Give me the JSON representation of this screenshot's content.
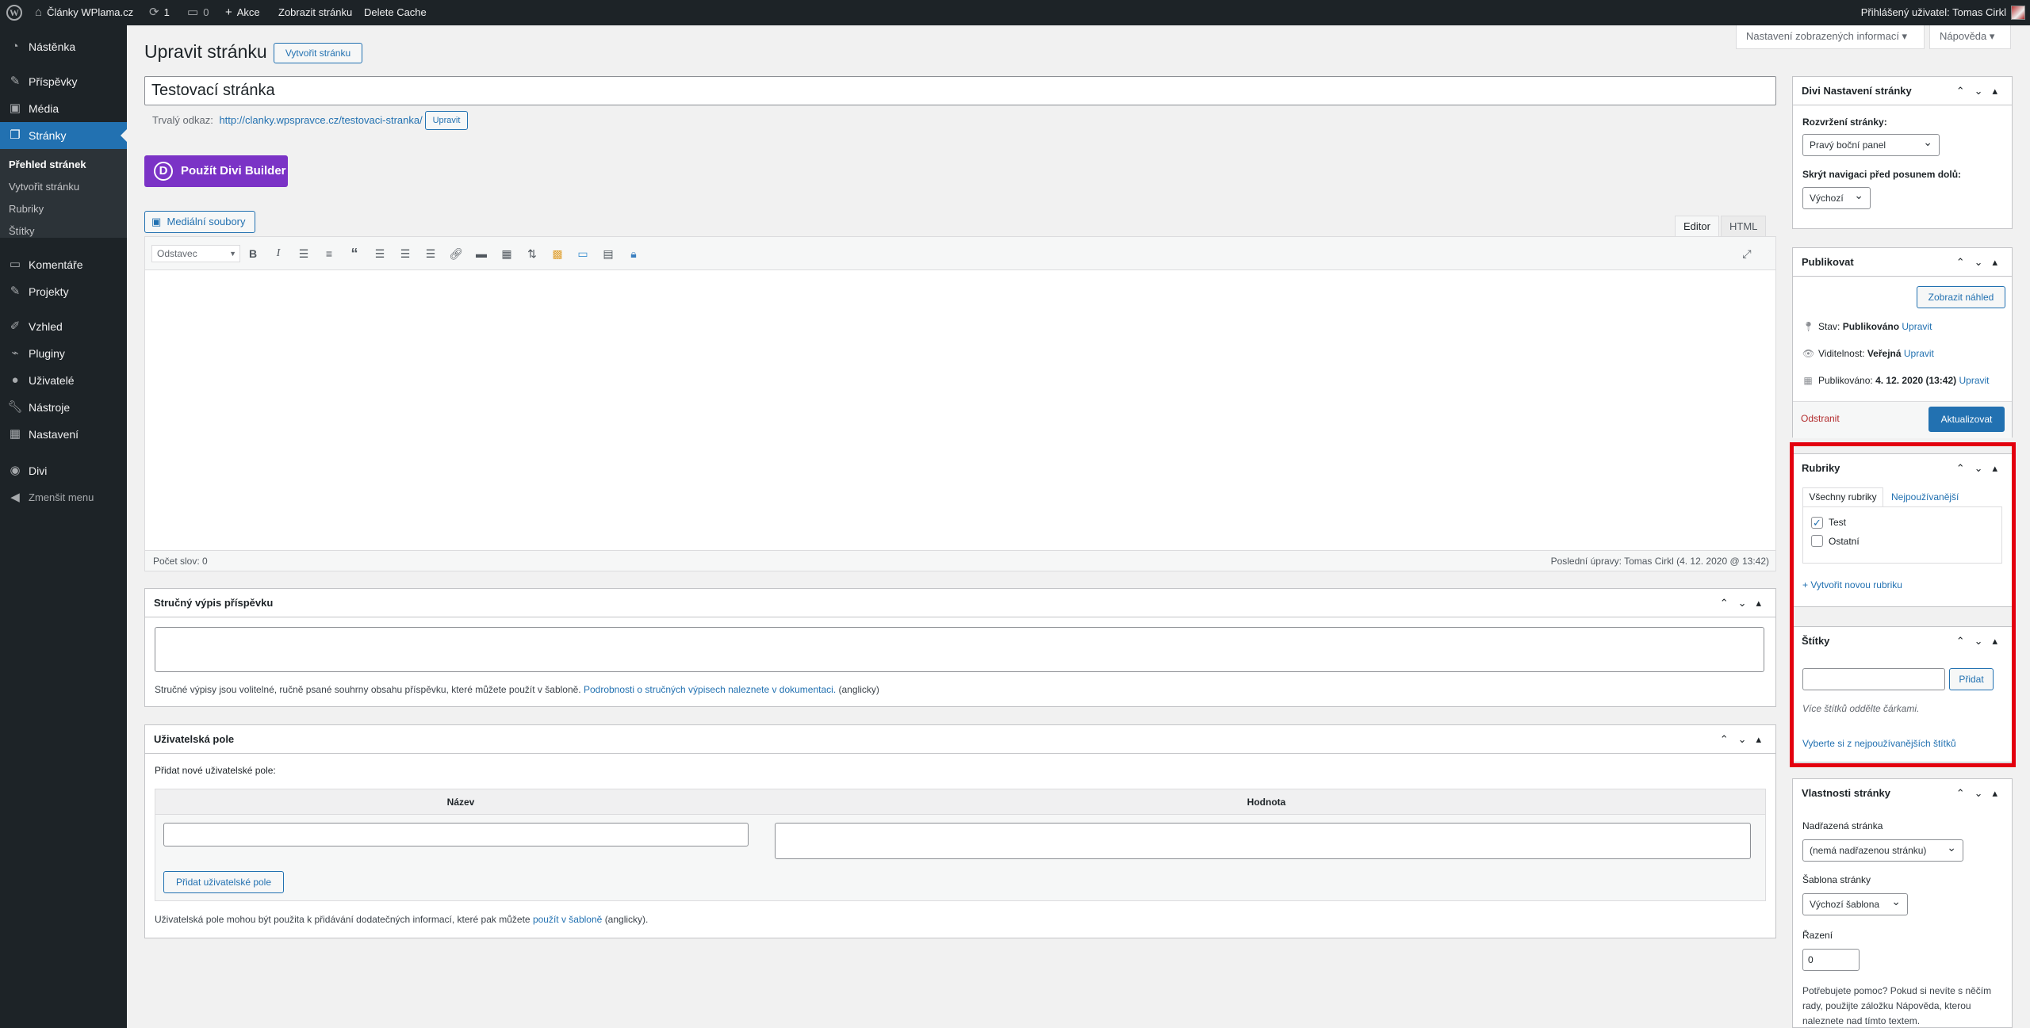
{
  "adminbar": {
    "site_name": "Články WPlama.cz",
    "updates_count": "1",
    "comments_count": "0",
    "new_label": "Akce",
    "view_page": "Zobrazit stránku",
    "delete_cache": "Delete Cache",
    "howdy": "Přihlášený uživatel: Tomas Cirkl"
  },
  "sidebar": {
    "items": [
      {
        "label": "Nástěnka",
        "icon": "dashboard-icon"
      },
      {
        "label": "Příspěvky",
        "icon": "pin-icon"
      },
      {
        "label": "Média",
        "icon": "media-icon"
      },
      {
        "label": "Stránky",
        "icon": "pages-icon"
      },
      {
        "label": "Komentáře",
        "icon": "comments-icon"
      },
      {
        "label": "Projekty",
        "icon": "pin-icon"
      },
      {
        "label": "Vzhled",
        "icon": "appearance-icon"
      },
      {
        "label": "Pluginy",
        "icon": "plugins-icon"
      },
      {
        "label": "Uživatelé",
        "icon": "users-icon"
      },
      {
        "label": "Nástroje",
        "icon": "tools-icon"
      },
      {
        "label": "Nastavení",
        "icon": "settings-icon"
      },
      {
        "label": "Divi",
        "icon": "divi-icon"
      },
      {
        "label": "Zmenšit menu",
        "icon": "collapse-icon"
      }
    ],
    "submenu": [
      "Přehled stránek",
      "Vytvořit stránku",
      "Rubriky",
      "Štítky"
    ]
  },
  "header": {
    "title": "Upravit stránku",
    "add_new": "Vytvořit stránku",
    "screen_options": "Nastavení zobrazených informací",
    "help": "Nápověda"
  },
  "post": {
    "title_value": "Testovací stránka",
    "permalink_label": "Trvalý odkaz:",
    "permalink_url": "http://clanky.wpspravce.cz/testovaci-stranka/",
    "permalink_edit": "Upravit",
    "divi_button": "Použít Divi Builder",
    "divi_letter": "D"
  },
  "editor": {
    "media_button": "Mediální soubory",
    "tab_visual": "Editor",
    "tab_html": "HTML",
    "format_select": "Odstavec",
    "word_count": "Počet slov: 0",
    "last_edit": "Poslední úpravy: Tomas Cirkl (4. 12. 2020 @ 13:42)"
  },
  "excerpt": {
    "title": "Stručný výpis příspěvku",
    "help_text": "Stručné výpisy jsou volitelné, ručně psané souhrny obsahu příspěvku, které můžete použít v šabloně.",
    "help_link": "Podrobnosti o stručných výpisech naleznete v dokumentaci.",
    "help_suffix": "(anglicky)"
  },
  "custom_fields": {
    "title": "Uživatelská pole",
    "add_new_label": "Přidat nové uživatelské pole:",
    "col_name": "Název",
    "col_value": "Hodnota",
    "add_button": "Přidat uživatelské pole",
    "help_text": "Uživatelská pole mohou být použita k přidávání dodatečných informací, které pak můžete",
    "help_link": "použít v šabloně",
    "help_suffix": "(anglicky)."
  },
  "divi_settings": {
    "title": "Divi Nastavení stránky",
    "layout_label": "Rozvržení stránky:",
    "layout_value": "Pravý boční panel",
    "hide_nav_label": "Skrýt navigaci před posunem dolů:",
    "hide_nav_value": "Výchozí"
  },
  "publish": {
    "title": "Publikovat",
    "preview": "Zobrazit náhled",
    "status_label": "Stav:",
    "status_value": "Publikováno",
    "visibility_label": "Viditelnost:",
    "visibility_value": "Veřejná",
    "published_label": "Publikováno:",
    "published_value": "4. 12. 2020 (13:42)",
    "edit": "Upravit",
    "trash": "Odstranit",
    "update": "Aktualizovat"
  },
  "categories": {
    "title": "Rubriky",
    "tab_all": "Všechny rubriky",
    "tab_popular": "Nejpoužívanější",
    "items": [
      {
        "label": "Test",
        "checked": true
      },
      {
        "label": "Ostatní",
        "checked": false
      }
    ],
    "add_new": "+ Vytvořit novou rubriku"
  },
  "tags": {
    "title": "Štítky",
    "add_button": "Přidat",
    "hint": "Více štítků oddělte čárkami.",
    "choose_link": "Vyberte si z nejpoužívanějších štítků"
  },
  "page_attributes": {
    "title": "Vlastnosti stránky",
    "parent_label": "Nadřazená stránka",
    "parent_value": "(nemá nadřazenou stránku)",
    "template_label": "Šablona stránky",
    "template_value": "Výchozí šablona",
    "order_label": "Řazení",
    "order_value": "0",
    "help_text": "Potřebujete pomoc? Pokud si nevíte s něčím rady, použijte záložku Nápověda, kterou naleznete nad tímto textem."
  },
  "colors": {
    "accent": "#2271b1",
    "divi": "#7b33c6",
    "highlight": "#e3000f",
    "sidebar_bg": "#1d2327"
  }
}
